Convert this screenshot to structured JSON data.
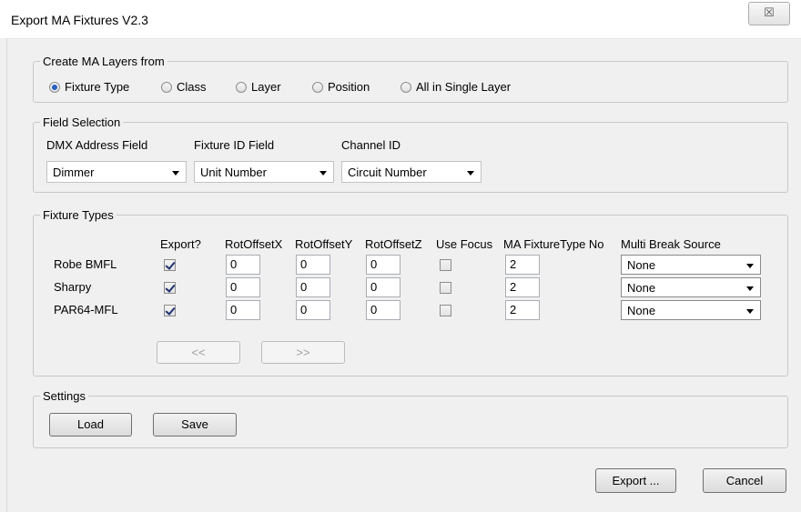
{
  "window": {
    "title": "Export MA Fixtures V2.3",
    "close_glyph": "☒"
  },
  "layers": {
    "legend": "Create MA Layers from",
    "options": [
      {
        "label": "Fixture Type",
        "selected": true
      },
      {
        "label": "Class",
        "selected": false
      },
      {
        "label": "Layer",
        "selected": false
      },
      {
        "label": "Position",
        "selected": false
      },
      {
        "label": "All in Single Layer",
        "selected": false
      }
    ]
  },
  "fields": {
    "legend": "Field Selection",
    "dmx_label": "DMX Address Field",
    "dmx_value": "Dimmer",
    "fixture_id_label": "Fixture ID Field",
    "fixture_id_value": "Unit Number",
    "channel_label": "Channel ID",
    "channel_value": "Circuit Number"
  },
  "fixture_types": {
    "legend": "Fixture Types",
    "columns": [
      "Export?",
      "RotOffsetX",
      "RotOffsetY",
      "RotOffsetZ",
      "Use Focus",
      "MA FixtureType No",
      "Multi Break Source"
    ],
    "rows": [
      {
        "name": "Robe BMFL",
        "export": true,
        "rotx": "0",
        "roty": "0",
        "rotz": "0",
        "use_focus": false,
        "type_no": "2",
        "source": "None"
      },
      {
        "name": "Sharpy",
        "export": true,
        "rotx": "0",
        "roty": "0",
        "rotz": "0",
        "use_focus": false,
        "type_no": "2",
        "source": "None"
      },
      {
        "name": "PAR64-MFL",
        "export": true,
        "rotx": "0",
        "roty": "0",
        "rotz": "0",
        "use_focus": false,
        "type_no": "2",
        "source": "None"
      }
    ],
    "prev_label": "<<",
    "next_label": ">>"
  },
  "settings": {
    "legend": "Settings",
    "load_label": "Load",
    "save_label": "Save"
  },
  "footer": {
    "export_label": "Export ...",
    "cancel_label": "Cancel"
  }
}
